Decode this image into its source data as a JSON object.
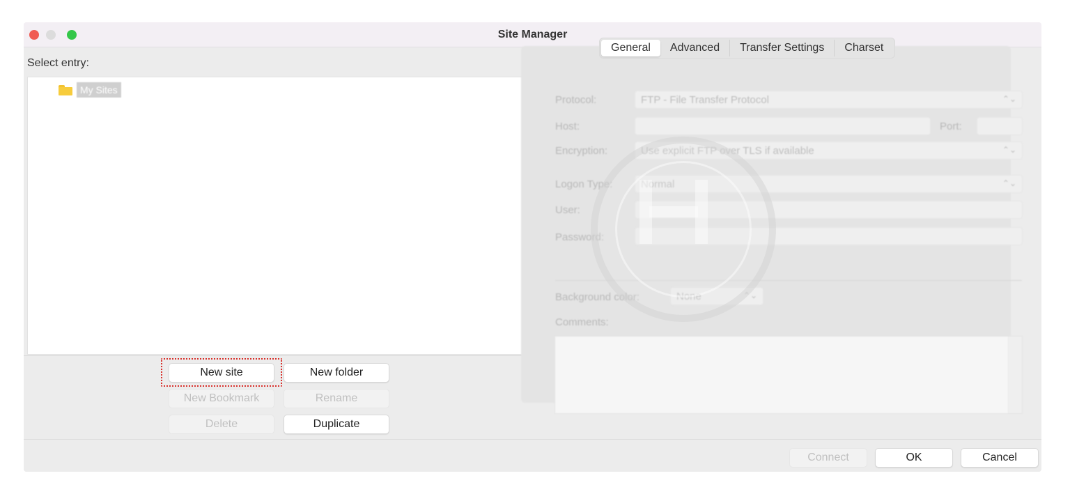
{
  "window": {
    "title": "Site Manager"
  },
  "left": {
    "select_label": "Select entry:",
    "tree": [
      {
        "label": "My Sites",
        "icon": "folder-icon"
      }
    ],
    "buttons": {
      "new_site": "New site",
      "new_folder": "New folder",
      "new_bookmark": "New Bookmark",
      "rename": "Rename",
      "delete": "Delete",
      "duplicate": "Duplicate"
    }
  },
  "tabs": [
    "General",
    "Advanced",
    "Transfer Settings",
    "Charset"
  ],
  "active_tab": "General",
  "form": {
    "protocol_label": "Protocol:",
    "protocol_value": "FTP - File Transfer Protocol",
    "host_label": "Host:",
    "host_value": "",
    "port_label": "Port:",
    "port_value": "",
    "encryption_label": "Encryption:",
    "encryption_value": "Use explicit FTP over TLS if available",
    "logon_label": "Logon Type:",
    "logon_value": "Normal",
    "user_label": "User:",
    "user_value": "",
    "password_label": "Password:",
    "password_value": "",
    "bgcolor_label": "Background color:",
    "bgcolor_value": "None",
    "comments_label": "Comments:"
  },
  "footer": {
    "connect": "Connect",
    "ok": "OK",
    "cancel": "Cancel"
  },
  "colors": {
    "highlight": "#d8302b",
    "folder": "#f7cc3c",
    "close": "#f05b52",
    "maximize": "#34c749"
  }
}
